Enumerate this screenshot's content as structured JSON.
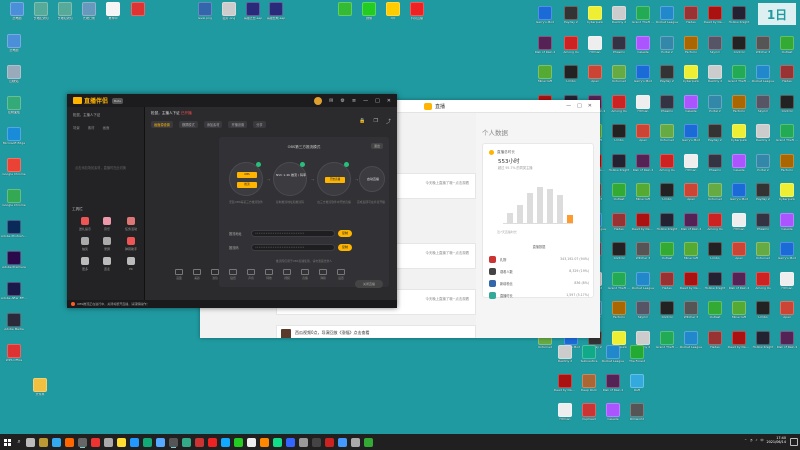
{
  "watermark": "1日",
  "top_icons": [
    {
      "label": "此电脑",
      "color": "#4a8fd8"
    },
    {
      "label": "长裙配通知",
      "color": "#5a9"
    },
    {
      "label": "长裙和通知",
      "color": "#5a9"
    },
    {
      "label": "长裙日前",
      "color": "#69b"
    },
    {
      "label": "推荐中",
      "color": "#f5f5f5"
    },
    {
      "label": "",
      "color": "#d33"
    },
    {
      "label": "level.png",
      "color": "#36a"
    },
    {
      "label": "图片.png",
      "color": "#ccc"
    },
    {
      "label": "海报之合.aep",
      "color": "#2a2a7a"
    },
    {
      "label": "海报合成.aep",
      "color": "#2a2a7a"
    },
    {
      "label": "",
      "color": "#3b3"
    },
    {
      "label": "微信",
      "color": "#2c2"
    },
    {
      "label": "QQ",
      "color": "#ffcc00"
    },
    {
      "label": "抖音直播",
      "color": "#e22"
    }
  ],
  "left_icons": [
    {
      "label": "此电脑",
      "color": "#4a8fd8"
    },
    {
      "label": "回收站",
      "color": "#9ab"
    },
    {
      "label": "控制面板",
      "color": "#3a7"
    },
    {
      "label": "Microsoft Edge",
      "color": "#1a8bd8"
    },
    {
      "label": "Google Chrome",
      "color": "#ea4335"
    },
    {
      "label": "Google Chrome",
      "color": "#34a853"
    },
    {
      "label": "Adobe Photoshop",
      "color": "#0a2a5a"
    },
    {
      "label": "Adobe Premiere",
      "color": "#2a0a4a"
    },
    {
      "label": "Adobe After Effects 2020",
      "color": "#1a1a4a"
    },
    {
      "label": "Adobe Media",
      "color": "#2a2a3a"
    },
    {
      "label": "WPS Office",
      "color": "#d33"
    },
    {
      "label": "文件夹",
      "color": "#f0c040"
    }
  ],
  "game_icons_a": [
    {
      "label": "Garry's Mod",
      "color": "#1a6ad8"
    },
    {
      "label": "Rust",
      "color": "#c33"
    },
    {
      "label": "Cyberpunk",
      "color": "#ee3"
    },
    {
      "label": "Counter-Strike",
      "color": "#caa060"
    },
    {
      "label": "Grand Theft Auto V",
      "color": "#2a5"
    },
    {
      "label": "Alien Isolation",
      "color": "#444"
    },
    {
      "label": "Hades",
      "color": "#933"
    },
    {
      "label": "Terraria",
      "color": "#5a8"
    },
    {
      "label": "Hollow Knight",
      "color": "#223"
    },
    {
      "label": "Stardew",
      "color": "#6a3"
    },
    {
      "label": "Among Us",
      "color": "#c22"
    },
    {
      "label": "Left 4 Dead",
      "color": "#822"
    },
    {
      "label": "Phasmo",
      "color": "#334"
    },
    {
      "label": "Dota 2",
      "color": "#a22"
    },
    {
      "label": "Portal 2",
      "color": "#38a"
    },
    {
      "label": "Borderlands",
      "color": "#fa2"
    },
    {
      "label": "Skyrim",
      "color": "#556"
    },
    {
      "label": "Fallout 4",
      "color": "#2a6"
    },
    {
      "label": "Witcher 3",
      "color": "#555"
    },
    {
      "label": "Doom",
      "color": "#a33"
    },
    {
      "label": "Minecraft",
      "color": "#5a3"
    },
    {
      "label": "Valheim",
      "color": "#465"
    },
    {
      "label": "Apex",
      "color": "#c43"
    },
    {
      "label": "PUBG",
      "color": "#d90"
    }
  ],
  "game_icons_b": [
    {
      "label": "Sea of Thieves",
      "color": "#3a8"
    },
    {
      "label": "Payday 2",
      "color": "#333"
    },
    {
      "label": "Overwatch",
      "color": "#f80"
    },
    {
      "label": "Destiny 2",
      "color": "#ccc"
    },
    {
      "label": "Subnautica",
      "color": "#1a8"
    },
    {
      "label": "Rocket League",
      "color": "#28c"
    },
    {
      "label": "The Forest",
      "color": "#2a3"
    },
    {
      "label": "Dead by Daylight",
      "color": "#a11"
    },
    {
      "label": "Deep Rock",
      "color": "#a63"
    },
    {
      "label": "Risk of Rain 2",
      "color": "#525"
    },
    {
      "label": "Raft",
      "color": "#3ad"
    },
    {
      "label": "Hitman",
      "color": "#eee"
    },
    {
      "label": "Cuphead",
      "color": "#c33"
    },
    {
      "label": "Celeste",
      "color": "#a5f"
    },
    {
      "label": "Rimworld",
      "color": "#555"
    },
    {
      "label": "Factorio",
      "color": "#a60"
    },
    {
      "label": "Half-Life",
      "color": "#f70"
    },
    {
      "label": "Control",
      "color": "#222"
    },
    {
      "label": "Titanfall 2",
      "color": "#555"
    },
    {
      "label": "Outlast",
      "color": "#3a3"
    },
    {
      "label": "Inside",
      "color": "#111"
    },
    {
      "label": "Limbo",
      "color": "#222"
    },
    {
      "label": "Journey",
      "color": "#d93"
    },
    {
      "label": "Unturned",
      "color": "#6a4"
    }
  ],
  "app_window": {
    "brand": "直播伴侣",
    "version": "Beta",
    "user": "松鼠，主播人下证",
    "side_tabs": [
      "场景",
      "素材",
      "画面"
    ],
    "side_hint": "点击添加场景素材，直播时在此切换",
    "section": "工具栏",
    "tools": [
      {
        "label": "送礼提示",
        "color": "#e55"
      },
      {
        "label": "音乐",
        "color": "#e9a"
      },
      {
        "label": "任务活动",
        "color": "#d77"
      },
      {
        "label": "抽奖",
        "color": "#aaa"
      },
      {
        "label": "录屏",
        "color": "#aaa"
      },
      {
        "label": "弹幕助手",
        "color": "#e55"
      },
      {
        "label": "更多",
        "color": "#bbb"
      },
      {
        "label": "连麦",
        "color": "#bbb"
      },
      {
        "label": "PK",
        "color": "#bbb"
      }
    ],
    "room_title": "松鼠，主播人下证",
    "live_badge": "已开播",
    "toolbar": [
      "画面源设置",
      "横屏模式",
      "添加素材",
      "开播设置",
      "分享"
    ],
    "guide": {
      "title": "OBS第三方推流模式",
      "close": "退出",
      "steps": [
        {
          "badge": "OBS",
          "badge2": "推流",
          "title": "",
          "caption": "安装OBS等第三方推流软件"
        },
        {
          "badge": "",
          "badge2": "",
          "title": "NVC 1.4K\n推流 / 码率",
          "caption": "复制推流地址和推流码"
        },
        {
          "badge": "开始直播",
          "badge2": "",
          "title": "",
          "caption": "在三方推流软件中开始直播"
        },
        {
          "badge": "",
          "badge2": "",
          "title": "启动直播",
          "caption": "完成后即可在抖音开播"
        }
      ],
      "fields": [
        {
          "label": "推流地址",
          "value": "••••••••••••••••••••••••••••",
          "button": "复制"
        },
        {
          "label": "推流码",
          "value": "••••••••••••••••••••••••••••",
          "button": "复制"
        }
      ],
      "note": "推流码仅用于OBS直播使用，请勿泄露给他人"
    },
    "bottom_tools": [
      "画面",
      "美颜",
      "滤镜",
      "贴纸",
      "声音",
      "特效",
      "视频",
      "直播",
      "弹幕",
      "设置"
    ],
    "go_live": "关闭直播",
    "status": "OBS推流正在进行中，关闭将断开直播，请谨慎操作！"
  },
  "white_window": {
    "title": "直播",
    "feed": [
      {
        "time": "06-14 15:47",
        "text": "今天晚上直播了哦~点击观看"
      },
      {
        "time": "06-14 15:47",
        "text": "今天晚上直播了哦~点击观看"
      },
      {
        "time": "06-14 15:47",
        "text": "今天晚上直播了哦~点击观看"
      }
    ],
    "feed_bottom_title": "西瓜视频0点，导演回放《涨幅》点击查看",
    "data_panel": {
      "heading": "个人数据",
      "card_title": "直播总时长",
      "big_value": "553小时",
      "sub_value": "超过 95.7% 的同类主播",
      "bars_caption": "近7天直播时长",
      "list_title": "直播数据",
      "rows": [
        {
          "name": "礼物",
          "value": "343,192.07 (94%)",
          "color": "#c33"
        },
        {
          "name": "观看人数",
          "value": "8,329 (19%)",
          "color": "#444"
        },
        {
          "name": "新增粉丝",
          "value": "836 (8%)",
          "color": "#36a"
        },
        {
          "name": "直播时长",
          "value": "1,597 (5.17%)",
          "color": "#3a9"
        }
      ]
    }
  },
  "taskbar": {
    "clock_time": "17:40",
    "clock_date": "2021/06/14",
    "lang": "中",
    "apps": [
      "#bbb",
      "#b93",
      "#3ae",
      "#f60",
      "#666",
      "#e33",
      "#aaa",
      "#fd3",
      "#29f",
      "#1a7",
      "#5af",
      "#555",
      "#3a8",
      "#c33",
      "#e22",
      "#1af",
      "#2c2",
      "#eee",
      "#f80",
      "#1d8",
      "#36f",
      "#999",
      "#444",
      "#c22",
      "#49f",
      "#aaa",
      "#3a3"
    ]
  }
}
